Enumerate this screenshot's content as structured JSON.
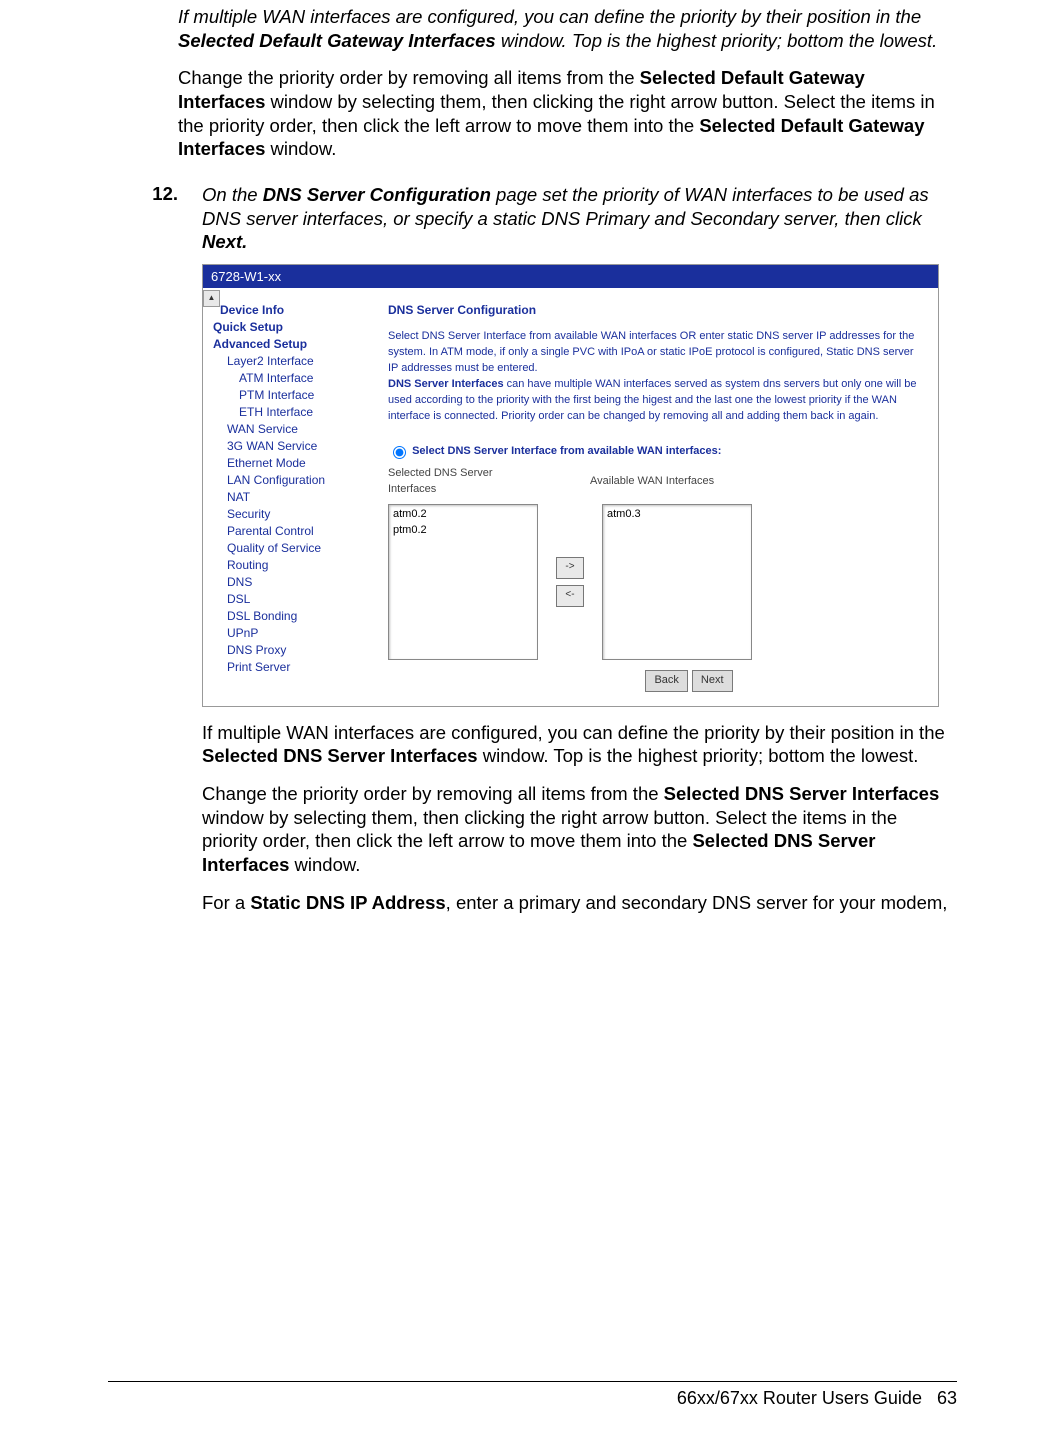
{
  "intro": {
    "para1_pre": "If multiple WAN interfaces are configured, you can define the priority by their position in the ",
    "para1_bold": "Selected Default Gateway Interfaces",
    "para1_post": " window. Top is the highest priority; bottom the lowest.",
    "para2_pre": "Change the priority order by removing all items from the ",
    "para2_bold1": "Selected Default Gateway Interfaces",
    "para2_mid": " window by selecting them, then clicking the right arrow button. Select the items in the priority order, then click the left arrow to move them into the ",
    "para2_bold2": "Selected Default Gateway Interfaces",
    "para2_post": " window."
  },
  "step12": {
    "num": "12.",
    "pre": "On the ",
    "bold1": "DNS Server Configuration",
    "mid": " page set the priority of WAN interfaces to be used as DNS server interfaces, or specify a static DNS Primary and Secondary server, then click ",
    "bold2": "Next."
  },
  "embedded": {
    "titlebar": "6728-W1-xx",
    "sidebar": [
      {
        "label": "Device Info",
        "lvl": 0
      },
      {
        "label": "Quick Setup",
        "lvl": 0
      },
      {
        "label": "Advanced Setup",
        "lvl": 0
      },
      {
        "label": "Layer2 Interface",
        "lvl": 1
      },
      {
        "label": "ATM Interface",
        "lvl": 2
      },
      {
        "label": "PTM Interface",
        "lvl": 2
      },
      {
        "label": "ETH Interface",
        "lvl": 2
      },
      {
        "label": "WAN Service",
        "lvl": 1
      },
      {
        "label": "3G WAN Service",
        "lvl": 1
      },
      {
        "label": "Ethernet Mode",
        "lvl": 1
      },
      {
        "label": "LAN Configuration",
        "lvl": 1
      },
      {
        "label": "NAT",
        "lvl": 1
      },
      {
        "label": "Security",
        "lvl": 1
      },
      {
        "label": "Parental Control",
        "lvl": 1
      },
      {
        "label": "Quality of Service",
        "lvl": 1
      },
      {
        "label": "Routing",
        "lvl": 1
      },
      {
        "label": "DNS",
        "lvl": 1
      },
      {
        "label": "DSL",
        "lvl": 1
      },
      {
        "label": "DSL Bonding",
        "lvl": 1
      },
      {
        "label": "UPnP",
        "lvl": 1
      },
      {
        "label": "DNS Proxy",
        "lvl": 1
      },
      {
        "label": "Print Server",
        "lvl": 1
      }
    ],
    "content": {
      "heading": "DNS Server Configuration",
      "para1": "Select DNS Server Interface from available WAN interfaces OR enter static DNS server IP addresses for the system. In ATM mode, if only a single PVC with IPoA or static IPoE protocol is configured, Static DNS server IP addresses must be entered.",
      "para2_bold": "DNS Server Interfaces",
      "para2_rest": " can have multiple WAN interfaces served as system dns servers but only one will be used according to the priority with the first being the higest and the last one the lowest priority if the WAN interface is connected. Priority order can be changed by removing all and adding them back in again.",
      "radio_label": "Select DNS Server Interface from available WAN interfaces:",
      "selected_label": "Selected DNS Server Interfaces",
      "available_label": "Available WAN Interfaces",
      "selected_items": [
        "atm0.2",
        "ptm0.2"
      ],
      "available_items": [
        "atm0.3"
      ],
      "arrow_right": "->",
      "arrow_left": "<-",
      "back": "Back",
      "next": "Next"
    }
  },
  "after": {
    "p1_pre": "If multiple WAN interfaces are configured, you can define the priority by their position in the ",
    "p1_bold": "Selected DNS Server Interfaces",
    "p1_post": " window. Top is the highest priority; bottom the lowest.",
    "p2_pre": "Change the priority order by removing all items from the ",
    "p2_bold1": "Selected DNS Server Interfaces",
    "p2_mid": " window by selecting them, then clicking the right arrow button. Select the items in the priority order, then click the left arrow to move them into the ",
    "p2_bold2": "Selected DNS Server Interfaces",
    "p2_post": " window.",
    "p3_pre": "For a ",
    "p3_bold": "Static DNS IP Address",
    "p3_post": ", enter a primary and secondary DNS server for your modem,"
  },
  "footer": {
    "title": "66xx/67xx Router Users Guide",
    "page": "63"
  }
}
